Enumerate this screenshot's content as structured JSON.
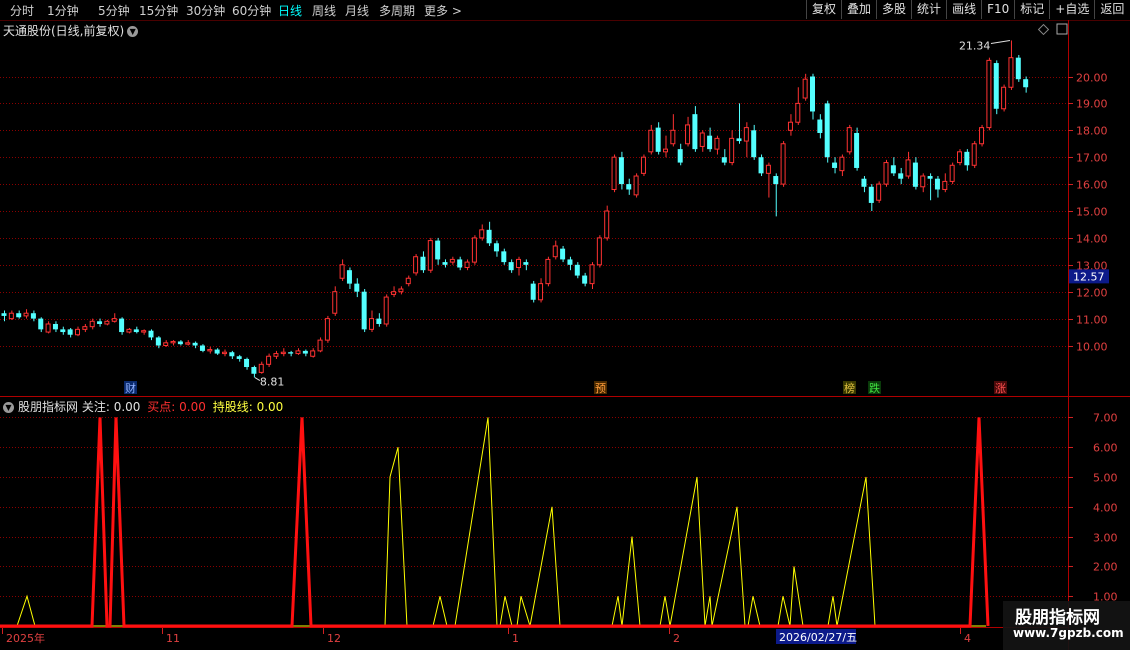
{
  "toolbar": {
    "periods": [
      "分时",
      "1分钟",
      "5分钟",
      "15分钟",
      "30分钟",
      "60分钟",
      "日线",
      "周线",
      "月线",
      "多周期",
      "更多 >"
    ],
    "active_period": "日线",
    "buttons": [
      "复权",
      "叠加",
      "多股",
      "统计",
      "画线",
      "F10",
      "标记",
      "+自选",
      "返回"
    ]
  },
  "stock_title": "天通股份(日线,前复权)",
  "price_axis": {
    "ticks": [
      "20.00",
      "19.00",
      "18.00",
      "17.00",
      "16.00",
      "15.00",
      "14.00",
      "13.00",
      "12.00",
      "11.00",
      "10.00"
    ],
    "current": "12.57",
    "high_label": "21.34",
    "low_label": "8.81"
  },
  "event_markers": [
    {
      "text": "财",
      "bg": "#0a2a6e",
      "fg": "#8fb0ff"
    },
    {
      "text": "预",
      "bg": "#4a2a00",
      "fg": "#ff9c3a"
    },
    {
      "text": "榜",
      "bg": "#3a3a00",
      "fg": "#e0c040"
    },
    {
      "text": "跌",
      "bg": "#0a3a0a",
      "fg": "#40e040"
    },
    {
      "text": "涨",
      "bg": "#4a0a0a",
      "fg": "#ff5050"
    }
  ],
  "indicator": {
    "name": "股朋指标网",
    "label1": "关注:",
    "value1": "0.00",
    "label2": "买点:",
    "value2": "0.00",
    "label3": "持股线:",
    "value3": "0.00",
    "ticks": [
      "7.00",
      "6.00",
      "5.00",
      "4.00",
      "3.00",
      "2.00",
      "1.00"
    ]
  },
  "date_axis": {
    "labels": [
      "2025年",
      "11",
      "12",
      "1",
      "2",
      "4"
    ],
    "cursor_date": "2026/02/27/五"
  },
  "watermark": {
    "name": "股朋指标网",
    "url": "www.7gpzb.com"
  },
  "colors": {
    "up": "#ff3232",
    "down": "#54ffff",
    "focus_line": "#ffff00",
    "buy_line": "#ff1010",
    "grid": "#8a0000"
  },
  "chart_data": [
    {
      "type": "candlestick",
      "title": "天通股份(日线,前复权)",
      "ylim": [
        8.0,
        21.8
      ],
      "candles": [
        [
          11.2,
          11.1,
          11.3,
          10.9
        ],
        [
          11.0,
          11.2,
          11.3,
          10.95
        ],
        [
          11.2,
          11.05,
          11.3,
          11.0
        ],
        [
          11.1,
          11.2,
          11.35,
          11.0
        ],
        [
          11.2,
          11.0,
          11.3,
          10.9
        ],
        [
          11.0,
          10.6,
          11.05,
          10.5
        ],
        [
          10.5,
          10.8,
          10.9,
          10.45
        ],
        [
          10.8,
          10.6,
          10.9,
          10.5
        ],
        [
          10.6,
          10.5,
          10.7,
          10.4
        ],
        [
          10.6,
          10.4,
          10.65,
          10.3
        ],
        [
          10.4,
          10.6,
          10.7,
          10.35
        ],
        [
          10.6,
          10.7,
          10.8,
          10.5
        ],
        [
          10.7,
          10.9,
          11.0,
          10.6
        ],
        [
          10.9,
          10.8,
          11.0,
          10.7
        ],
        [
          10.8,
          10.9,
          10.95,
          10.75
        ],
        [
          10.9,
          11.0,
          11.2,
          10.85
        ],
        [
          11.0,
          10.5,
          11.05,
          10.4
        ],
        [
          10.5,
          10.6,
          10.65,
          10.45
        ],
        [
          10.6,
          10.5,
          10.7,
          10.45
        ],
        [
          10.5,
          10.55,
          10.6,
          10.4
        ],
        [
          10.55,
          10.3,
          10.6,
          10.2
        ],
        [
          10.3,
          10.0,
          10.35,
          9.9
        ],
        [
          10.0,
          10.1,
          10.2,
          9.95
        ],
        [
          10.1,
          10.15,
          10.2,
          10.0
        ],
        [
          10.15,
          10.05,
          10.2,
          10.0
        ],
        [
          10.05,
          10.1,
          10.2,
          10.0
        ],
        [
          10.1,
          10.0,
          10.15,
          9.9
        ],
        [
          10.0,
          9.8,
          10.05,
          9.75
        ],
        [
          9.8,
          9.85,
          9.95,
          9.7
        ],
        [
          9.85,
          9.7,
          9.9,
          9.65
        ],
        [
          9.7,
          9.75,
          9.85,
          9.6
        ],
        [
          9.75,
          9.6,
          9.8,
          9.5
        ],
        [
          9.6,
          9.5,
          9.65,
          9.4
        ],
        [
          9.5,
          9.2,
          9.55,
          9.1
        ],
        [
          9.2,
          8.95,
          9.25,
          8.81
        ],
        [
          9.0,
          9.3,
          9.4,
          8.95
        ],
        [
          9.3,
          9.6,
          9.7,
          9.2
        ],
        [
          9.6,
          9.7,
          9.8,
          9.5
        ],
        [
          9.7,
          9.75,
          9.9,
          9.6
        ],
        [
          9.75,
          9.7,
          9.8,
          9.6
        ],
        [
          9.7,
          9.8,
          9.9,
          9.65
        ],
        [
          9.8,
          9.7,
          9.85,
          9.6
        ],
        [
          9.6,
          9.8,
          9.9,
          9.55
        ],
        [
          9.8,
          10.2,
          10.3,
          9.75
        ],
        [
          10.2,
          11.0,
          11.1,
          10.1
        ],
        [
          11.2,
          12.0,
          12.2,
          11.1
        ],
        [
          12.5,
          13.0,
          13.2,
          12.4
        ],
        [
          12.8,
          12.3,
          12.9,
          12.1
        ],
        [
          12.3,
          12.0,
          12.5,
          11.8
        ],
        [
          12.0,
          10.6,
          12.1,
          10.5
        ],
        [
          10.6,
          11.0,
          11.3,
          10.5
        ],
        [
          11.0,
          10.8,
          11.2,
          10.7
        ],
        [
          10.8,
          11.8,
          11.9,
          10.7
        ],
        [
          11.9,
          12.0,
          12.2,
          11.8
        ],
        [
          12.0,
          12.1,
          12.2,
          11.9
        ],
        [
          12.3,
          12.5,
          12.6,
          12.2
        ],
        [
          12.7,
          13.3,
          13.4,
          12.6
        ],
        [
          13.3,
          12.8,
          13.5,
          12.7
        ],
        [
          12.8,
          13.9,
          14.0,
          12.7
        ],
        [
          13.9,
          13.2,
          14.0,
          13.0
        ],
        [
          13.1,
          13.0,
          13.2,
          12.9
        ],
        [
          13.1,
          13.2,
          13.3,
          13.0
        ],
        [
          13.2,
          12.9,
          13.3,
          12.8
        ],
        [
          12.9,
          13.1,
          13.2,
          12.8
        ],
        [
          13.1,
          14.0,
          14.1,
          13.0
        ],
        [
          14.0,
          14.3,
          14.5,
          13.9
        ],
        [
          14.3,
          13.8,
          14.6,
          13.7
        ],
        [
          13.8,
          13.5,
          13.9,
          13.3
        ],
        [
          13.5,
          13.1,
          13.6,
          13.0
        ],
        [
          13.1,
          12.8,
          13.2,
          12.7
        ],
        [
          12.9,
          13.2,
          13.3,
          12.6
        ],
        [
          13.1,
          13.0,
          13.2,
          12.8
        ],
        [
          12.3,
          11.7,
          12.4,
          11.6
        ],
        [
          11.7,
          12.3,
          12.5,
          11.6
        ],
        [
          12.3,
          13.2,
          13.3,
          12.2
        ],
        [
          13.3,
          13.7,
          13.9,
          13.2
        ],
        [
          13.6,
          13.2,
          13.7,
          13.1
        ],
        [
          13.2,
          13.0,
          13.3,
          12.8
        ],
        [
          13.0,
          12.6,
          13.1,
          12.5
        ],
        [
          12.6,
          12.3,
          12.7,
          12.2
        ],
        [
          12.3,
          13.0,
          13.1,
          12.1
        ],
        [
          13.0,
          14.0,
          14.1,
          12.9
        ],
        [
          14.0,
          15.0,
          15.2,
          13.9
        ],
        [
          15.8,
          17.0,
          17.1,
          15.7
        ],
        [
          17.0,
          16.0,
          17.2,
          15.8
        ],
        [
          16.0,
          15.8,
          16.2,
          15.6
        ],
        [
          15.6,
          16.3,
          16.4,
          15.5
        ],
        [
          16.4,
          17.0,
          17.1,
          16.3
        ],
        [
          17.2,
          18.0,
          18.2,
          17.1
        ],
        [
          18.1,
          17.2,
          18.3,
          17.1
        ],
        [
          17.2,
          17.3,
          17.8,
          17.0
        ],
        [
          17.5,
          18.0,
          18.6,
          17.4
        ],
        [
          17.3,
          16.8,
          17.5,
          16.7
        ],
        [
          17.5,
          18.2,
          18.5,
          17.4
        ],
        [
          18.6,
          17.3,
          18.9,
          17.2
        ],
        [
          17.4,
          17.9,
          18.0,
          17.2
        ],
        [
          17.8,
          17.3,
          18.1,
          17.2
        ],
        [
          17.3,
          17.7,
          17.8,
          17.1
        ],
        [
          17.0,
          16.8,
          17.3,
          16.7
        ],
        [
          16.8,
          17.7,
          18.0,
          16.7
        ],
        [
          17.7,
          17.6,
          19.0,
          17.5
        ],
        [
          17.6,
          18.1,
          18.3,
          17.0
        ],
        [
          18.0,
          17.0,
          18.2,
          16.9
        ],
        [
          17.0,
          16.4,
          17.1,
          16.3
        ],
        [
          16.4,
          16.7,
          16.8,
          15.5
        ],
        [
          16.3,
          16.0,
          16.4,
          14.8
        ],
        [
          16.0,
          17.5,
          17.6,
          15.9
        ],
        [
          18.0,
          18.3,
          18.6,
          17.8
        ],
        [
          18.3,
          19.0,
          19.6,
          18.2
        ],
        [
          19.2,
          19.9,
          20.1,
          19.1
        ],
        [
          20.0,
          18.7,
          20.1,
          18.4
        ],
        [
          18.4,
          17.9,
          18.6,
          17.7
        ],
        [
          19.0,
          17.0,
          19.1,
          16.8
        ],
        [
          16.8,
          16.6,
          17.0,
          16.4
        ],
        [
          16.5,
          17.0,
          17.1,
          16.3
        ],
        [
          17.2,
          18.1,
          18.2,
          17.1
        ],
        [
          17.9,
          16.6,
          18.1,
          16.5
        ],
        [
          16.2,
          15.9,
          16.3,
          15.7
        ],
        [
          15.9,
          15.3,
          16.0,
          15.0
        ],
        [
          15.4,
          16.0,
          16.1,
          15.3
        ],
        [
          16.0,
          16.8,
          16.9,
          15.9
        ],
        [
          16.7,
          16.4,
          17.0,
          16.3
        ],
        [
          16.4,
          16.2,
          16.6,
          16.0
        ],
        [
          16.3,
          16.9,
          17.2,
          16.2
        ],
        [
          16.8,
          15.9,
          17.0,
          15.8
        ],
        [
          15.9,
          16.3,
          16.4,
          15.7
        ],
        [
          16.3,
          16.2,
          16.4,
          15.4
        ],
        [
          16.2,
          15.8,
          16.3,
          15.5
        ],
        [
          15.8,
          16.1,
          16.4,
          15.7
        ],
        [
          16.1,
          16.7,
          16.8,
          16.0
        ],
        [
          16.8,
          17.2,
          17.3,
          16.7
        ],
        [
          17.2,
          16.7,
          17.3,
          16.5
        ],
        [
          16.7,
          17.5,
          17.6,
          16.6
        ],
        [
          17.5,
          18.1,
          18.2,
          17.4
        ],
        [
          18.1,
          20.6,
          20.7,
          18.0
        ],
        [
          20.5,
          18.8,
          20.6,
          18.6
        ],
        [
          18.8,
          19.6,
          19.7,
          18.7
        ],
        [
          19.6,
          20.7,
          21.34,
          19.5
        ],
        [
          20.7,
          19.9,
          20.8,
          19.8
        ],
        [
          19.9,
          19.6,
          20.0,
          19.4
        ]
      ]
    },
    {
      "type": "line",
      "title": "股朋指标网",
      "ylim": [
        0,
        7.5
      ],
      "series": [
        {
          "name": "关注",
          "points": [
            [
              0,
              0
            ],
            [
              17,
              0
            ],
            [
              27,
              1
            ],
            [
              35,
              0
            ],
            [
              100,
              0
            ],
            [
              385,
              0
            ],
            [
              390,
              5
            ],
            [
              398,
              6
            ],
            [
              407,
              0
            ],
            [
              433,
              0
            ],
            [
              440,
              1
            ],
            [
              447,
              0
            ],
            [
              455,
              0
            ],
            [
              488,
              7
            ],
            [
              497,
              0
            ],
            [
              500,
              0
            ],
            [
              505,
              1
            ],
            [
              512,
              0
            ],
            [
              517,
              0
            ],
            [
              521,
              1
            ],
            [
              530,
              0
            ],
            [
              552,
              4
            ],
            [
              560,
              0
            ],
            [
              612,
              0
            ],
            [
              618,
              1
            ],
            [
              622,
              0
            ],
            [
              632,
              3
            ],
            [
              640,
              0
            ],
            [
              660,
              0
            ],
            [
              665,
              1
            ],
            [
              670,
              0
            ],
            [
              697,
              5
            ],
            [
              705,
              0
            ],
            [
              710,
              1
            ],
            [
              712,
              0
            ],
            [
              737,
              4
            ],
            [
              745,
              0
            ],
            [
              748,
              0
            ],
            [
              753,
              1
            ],
            [
              760,
              0
            ],
            [
              778,
              0
            ],
            [
              783,
              1
            ],
            [
              790,
              0
            ],
            [
              794,
              2
            ],
            [
              803,
              0
            ],
            [
              828,
              0
            ],
            [
              833,
              1
            ],
            [
              837,
              0
            ],
            [
              866,
              5
            ],
            [
              875,
              0
            ],
            [
              986,
              0
            ]
          ]
        },
        {
          "name": "买点",
          "points": [
            [
              0,
              0
            ],
            [
              92,
              0
            ],
            [
              100,
              7
            ],
            [
              107,
              0
            ],
            [
              110,
              0
            ],
            [
              116,
              7
            ],
            [
              124,
              0
            ],
            [
              292,
              0
            ],
            [
              302,
              7
            ],
            [
              311,
              0
            ],
            [
              970,
              0
            ],
            [
              979,
              7
            ],
            [
              988,
              0
            ]
          ]
        }
      ]
    }
  ]
}
